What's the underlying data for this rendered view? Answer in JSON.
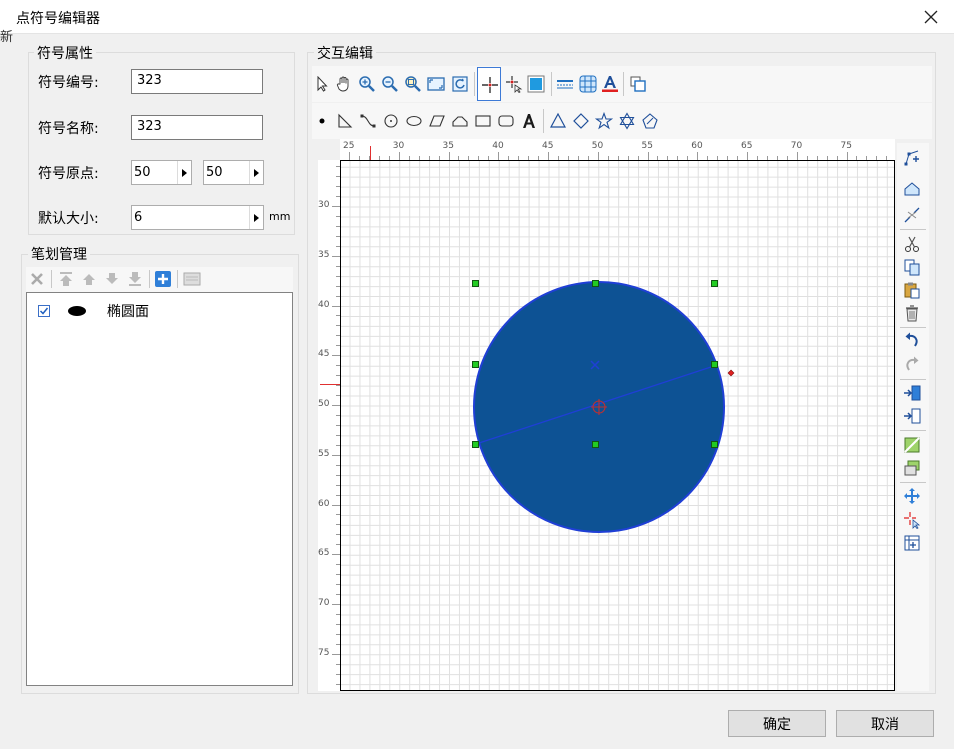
{
  "window": {
    "title": "点符号编辑器",
    "background_text": "新"
  },
  "symbol_props": {
    "group_title": "符号属性",
    "number_label": "符号编号:",
    "number_value": "323",
    "name_label": "符号名称:",
    "name_value": "323",
    "origin_label": "符号原点:",
    "origin_x": "50",
    "origin_y": "50",
    "size_label": "默认大小:",
    "size_value": "6",
    "size_unit": "mm"
  },
  "stroke_mgmt": {
    "group_title": "笔划管理",
    "items": [
      {
        "label": "椭圆面",
        "checked": true
      }
    ]
  },
  "interactive_edit": {
    "group_title": "交互编辑"
  },
  "ruler": {
    "top_labels": [
      "25",
      "30",
      "35",
      "40",
      "45",
      "50",
      "55",
      "60",
      "65",
      "70",
      "75"
    ],
    "left_labels": [
      "30",
      "35",
      "40",
      "45",
      "50",
      "55",
      "60",
      "65",
      "70",
      "75"
    ]
  },
  "buttons": {
    "ok": "确定",
    "cancel": "取消"
  },
  "colors": {
    "ellipse_fill": "#0d5294",
    "ellipse_stroke": "#1f3fd6",
    "handle": "#22cc22",
    "origin_marker": "#e03030",
    "grid": "#e0e0e0"
  }
}
